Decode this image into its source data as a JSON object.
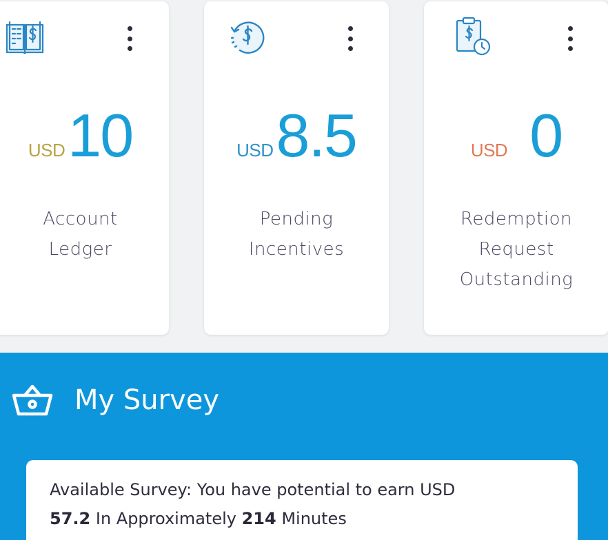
{
  "cards": [
    {
      "icon": "ledger-book-dollar-icon",
      "currency": "USD",
      "currency_color": "#b8a344",
      "amount": "10",
      "label_lines": [
        "Account",
        "Ledger"
      ]
    },
    {
      "icon": "refresh-dollar-icon",
      "currency": "USD",
      "currency_color": "#2f92c8",
      "amount": "8.5",
      "label_lines": [
        "Pending",
        "Incentives"
      ]
    },
    {
      "icon": "clipboard-clock-dollar-icon",
      "currency": "USD",
      "currency_color": "#e07a55",
      "amount": "0",
      "label_lines": [
        "Redemption",
        "Request",
        "Outstanding"
      ]
    }
  ],
  "survey": {
    "icon": "basket-icon",
    "title": "My Survey",
    "text_prefix": "Available Survey: You have potential to earn USD",
    "amount": "57.2",
    "text_middle": "In Approximately",
    "minutes": "214",
    "text_suffix": "Minutes"
  },
  "colors": {
    "accent": "#1a9ed7",
    "band": "#0e96dd",
    "icon_blue": "#2a86c4"
  }
}
